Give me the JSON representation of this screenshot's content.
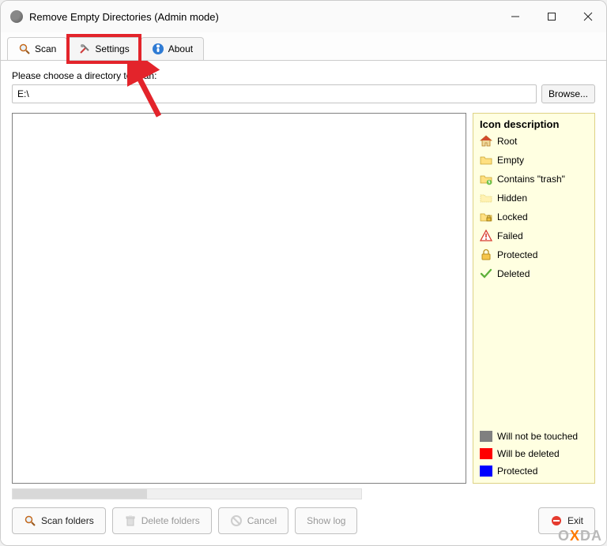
{
  "window": {
    "title": "Remove Empty Directories (Admin mode)"
  },
  "tabs": {
    "scan": "Scan",
    "settings": "Settings",
    "about": "About"
  },
  "prompt": "Please choose a directory to scan:",
  "path_value": "E:\\",
  "browse_label": "Browse...",
  "legend": {
    "title": "Icon description",
    "root": "Root",
    "empty": "Empty",
    "trash": "Contains \"trash\"",
    "hidden": "Hidden",
    "locked": "Locked",
    "failed": "Failed",
    "protected_icon": "Protected",
    "deleted": "Deleted",
    "not_touched": "Will not be touched",
    "deleted_color": "Will be deleted",
    "protected_color": "Protected"
  },
  "buttons": {
    "scan": "Scan folders",
    "delete": "Delete folders",
    "cancel": "Cancel",
    "showlog": "Show log",
    "exit": "Exit"
  },
  "watermark": {
    "pre": "O",
    "mid": "X",
    "post": "DA"
  }
}
